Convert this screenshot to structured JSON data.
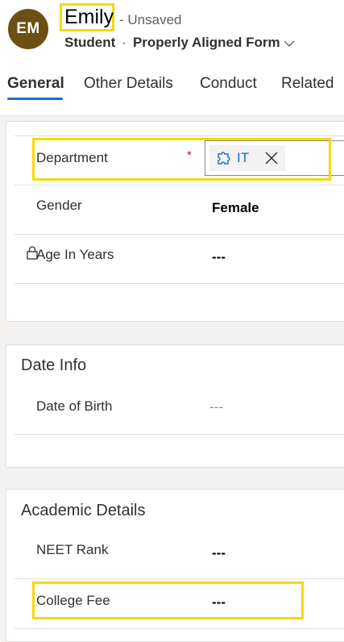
{
  "header": {
    "avatar_initials": "EM",
    "title": "Emily",
    "status": "- Unsaved",
    "entity": "Student",
    "separator": "·",
    "form_name": "Properly Aligned Form"
  },
  "tabs": [
    {
      "label": "General",
      "active": true
    },
    {
      "label": "Other Details",
      "active": false
    },
    {
      "label": "Conduct",
      "active": false
    },
    {
      "label": "Related",
      "active": false
    }
  ],
  "general_section": {
    "department": {
      "label": "Department",
      "required_marker": "*",
      "value": "IT"
    },
    "gender": {
      "label": "Gender",
      "value": "Female"
    },
    "age": {
      "label": "Age In Years",
      "value": "---"
    }
  },
  "date_info": {
    "title": "Date Info",
    "dob": {
      "label": "Date of Birth",
      "value": "---"
    }
  },
  "academic": {
    "title": "Academic Details",
    "neet": {
      "label": "NEET Rank",
      "value": "---"
    },
    "fee": {
      "label": "College Fee",
      "value": "---"
    }
  },
  "colors": {
    "avatar_bg": "#6b4f13",
    "accent": "#1e6bd6",
    "highlight": "#f5d90a",
    "required": "#a4262c"
  },
  "icons": {
    "chevron": "chevron-down-icon",
    "lookup_entity": "puzzle-icon",
    "remove": "close-icon",
    "lock": "lock-icon"
  }
}
